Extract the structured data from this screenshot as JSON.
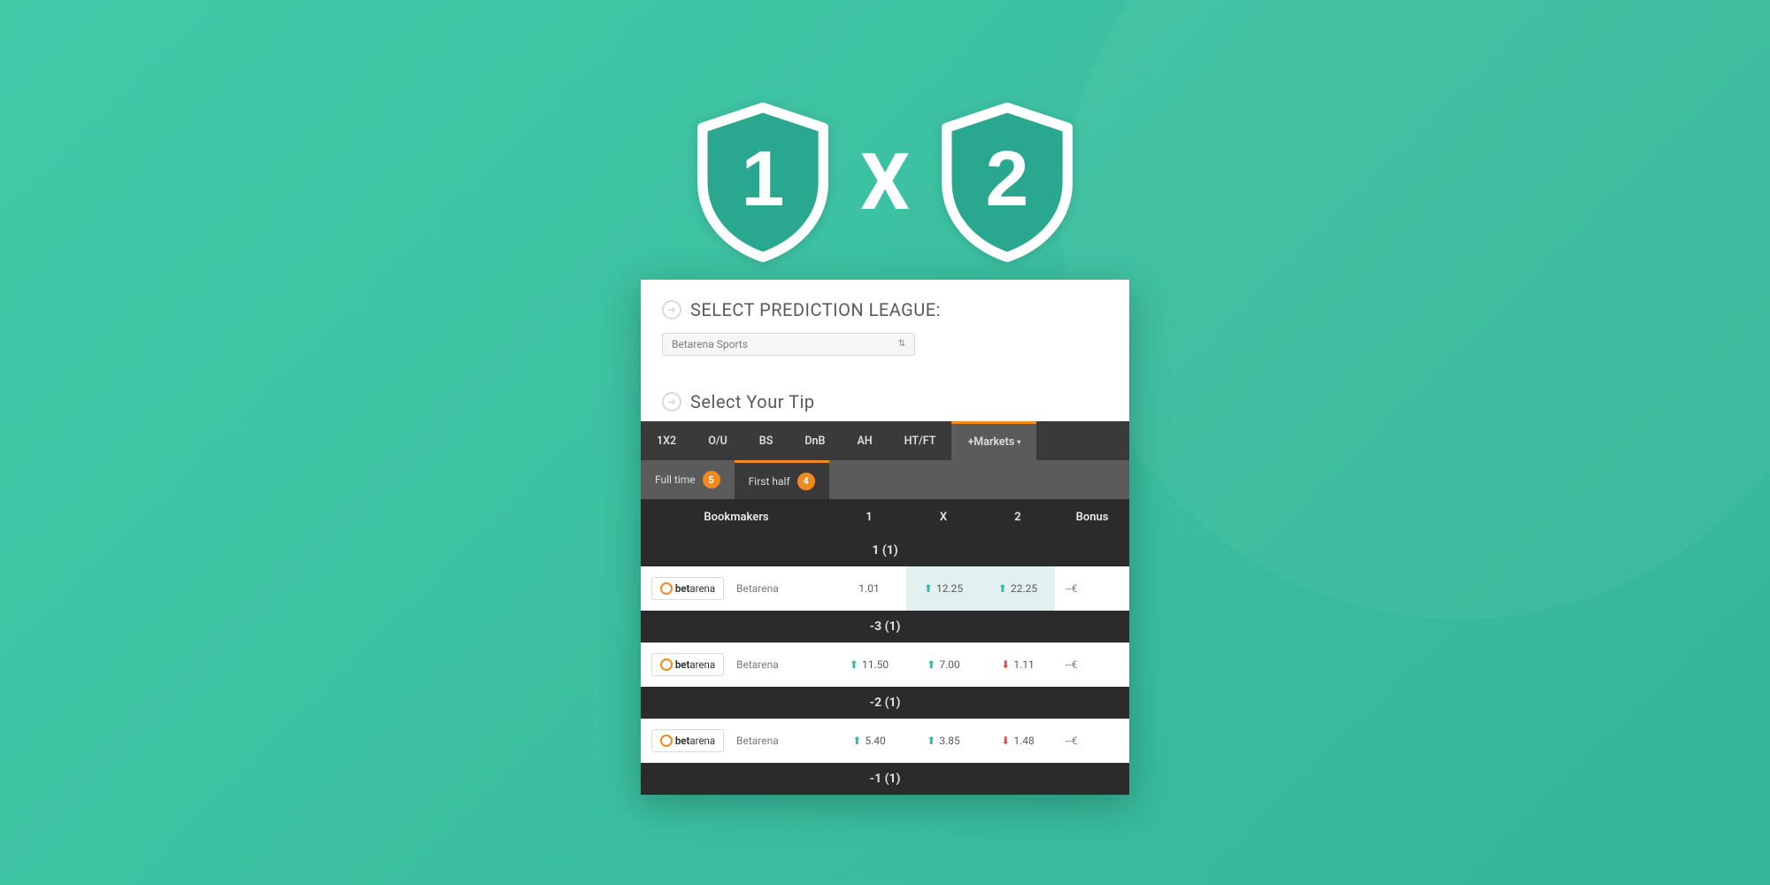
{
  "hero": {
    "left": "1",
    "mid": "X",
    "right": "2"
  },
  "section1": {
    "title": "Select Prediction League:"
  },
  "section2": {
    "title": "Select Your Tip"
  },
  "select": {
    "value": "Betarena Sports"
  },
  "tabs": [
    "1X2",
    "O/U",
    "BS",
    "DnB",
    "AH",
    "HT/FT",
    "+Markets"
  ],
  "subtabs": [
    {
      "label": "Full time",
      "count": "5"
    },
    {
      "label": "First half",
      "count": "4"
    }
  ],
  "headers": {
    "bm": "Bookmakers",
    "c1": "1",
    "cx": "X",
    "c2": "2",
    "bonus": "Bonus"
  },
  "bookmaker": {
    "logo_bold": "bet",
    "logo_rest": "arena",
    "name": "Betarena"
  },
  "groups": [
    {
      "label": "1 (1)",
      "row": {
        "c1": {
          "val": "1.01",
          "dir": "",
          "hi": false
        },
        "cx": {
          "val": "12.25",
          "dir": "up",
          "hi": true
        },
        "c2": {
          "val": "22.25",
          "dir": "up",
          "hi": true
        },
        "bonus": "--€"
      }
    },
    {
      "label": "-3 (1)",
      "row": {
        "c1": {
          "val": "11.50",
          "dir": "up",
          "hi": false
        },
        "cx": {
          "val": "7.00",
          "dir": "up",
          "hi": false
        },
        "c2": {
          "val": "1.11",
          "dir": "down",
          "hi": false
        },
        "bonus": "--€"
      }
    },
    {
      "label": "-2 (1)",
      "row": {
        "c1": {
          "val": "5.40",
          "dir": "up",
          "hi": false
        },
        "cx": {
          "val": "3.85",
          "dir": "up",
          "hi": false
        },
        "c2": {
          "val": "1.48",
          "dir": "down",
          "hi": false
        },
        "bonus": "--€"
      }
    },
    {
      "label": "-1 (1)",
      "row": null
    }
  ]
}
